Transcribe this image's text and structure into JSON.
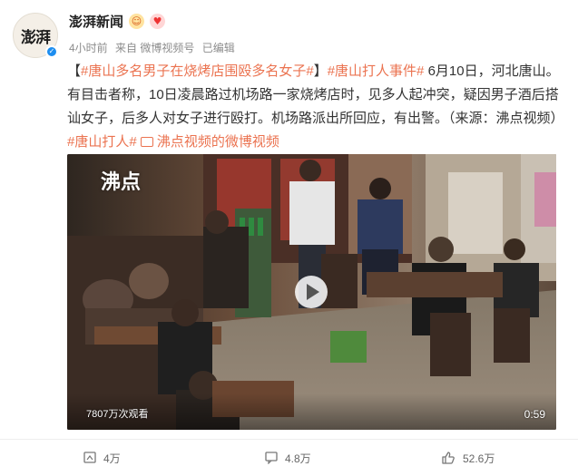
{
  "post": {
    "author": "澎湃新闻",
    "avatar_text": "澎湃",
    "time": "4小时前",
    "source": "来自 微博视频号",
    "edited": "已编辑",
    "text_segments": [
      {
        "text": "【",
        "style": "plain"
      },
      {
        "text": "#唐山多名男子在烧烤店围殴多名女子#",
        "style": "topic"
      },
      {
        "text": "】",
        "style": "plain"
      },
      {
        "text": "#唐山打人事件#",
        "style": "topic"
      },
      {
        "text": " 6月10日，河北唐山。有目击者称，10日凌晨路过机场路一家烧烤店时，见多人起冲突，疑因男子酒后搭讪女子，后多人对女子进行殴打。机场路派出所回应，有出警。（来源：沸点视频）",
        "style": "plain"
      },
      {
        "text": "#唐山打人#",
        "style": "topic"
      },
      {
        "text": " ",
        "style": "plain"
      }
    ],
    "link_text": "沸点视频的微博视频"
  },
  "video": {
    "watermark": "沸点",
    "views": "7807万次观看",
    "duration": "0:59"
  },
  "actions": {
    "repost_count": "4万",
    "comment_count": "4.8万",
    "like_count": "52.6万"
  },
  "colors": {
    "accent": "#eb7350",
    "verify": "#1d8ef0"
  }
}
